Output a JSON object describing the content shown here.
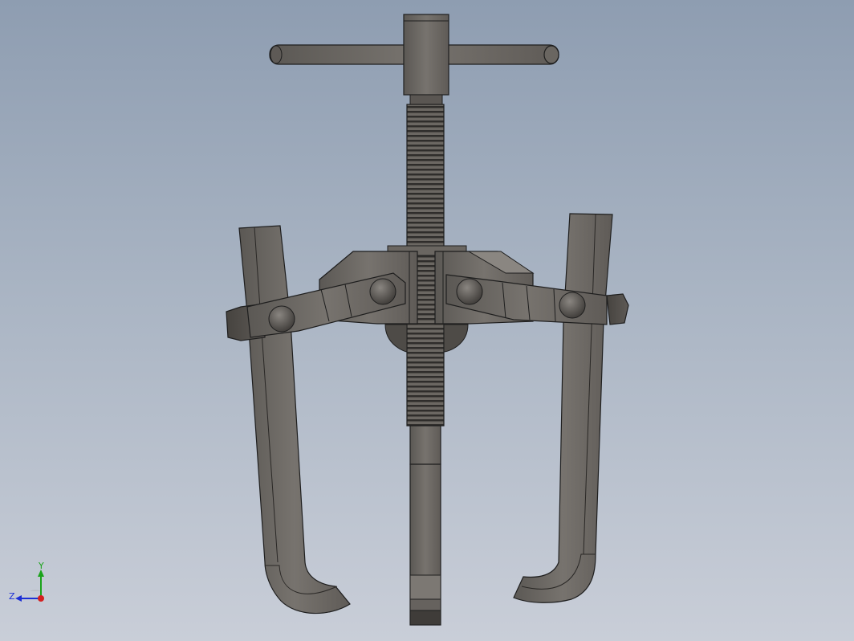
{
  "viewport": {
    "background_top": "#8e9db1",
    "background_bottom": "#c9ced8"
  },
  "model": {
    "part": "three-jaw-gear-puller",
    "body_color": "#6f6b66",
    "edge_color": "#1e1e1e"
  },
  "triad": {
    "y_label": "Y",
    "z_label": "Z",
    "y_color": "#1aa31a",
    "z_color": "#1c2fd6",
    "x_color": "#d41f1f"
  }
}
